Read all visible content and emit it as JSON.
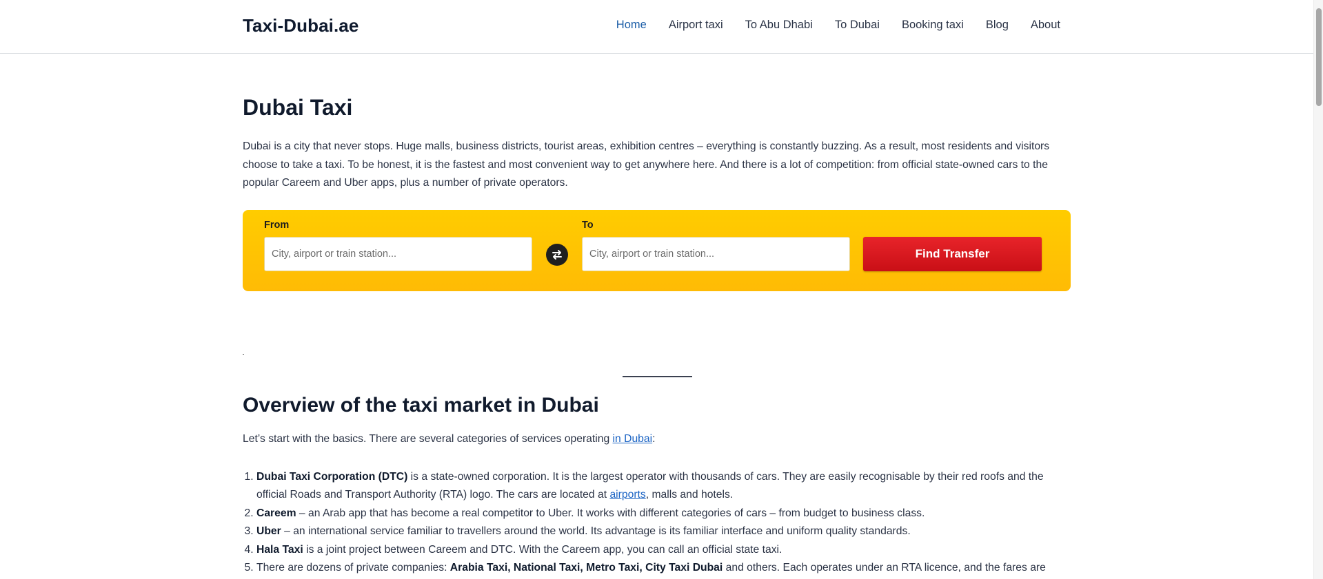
{
  "header": {
    "logo": "Taxi-Dubai.ae",
    "nav": [
      {
        "label": "Home",
        "active": true
      },
      {
        "label": "Airport taxi"
      },
      {
        "label": "To Abu Dhabi"
      },
      {
        "label": "To Dubai"
      },
      {
        "label": "Booking taxi"
      },
      {
        "label": "Blog"
      },
      {
        "label": "About"
      }
    ]
  },
  "hero": {
    "title": "Dubai Taxi",
    "intro": "Dubai is a city that never stops. Huge malls, business districts, tourist areas, exhibition centres – everything is constantly buzzing. As a result, most residents and visitors choose to take a taxi. To be honest, it is the fastest and most convenient way to get anywhere here. And there is a lot of competition: from official state-owned cars to the popular Careem and Uber apps, plus a number of private operators."
  },
  "search": {
    "from_label": "From",
    "from_placeholder": "City, airport or train station...",
    "to_label": "To",
    "to_placeholder": "City, airport or train station...",
    "swap_icon": "swap-arrows-icon",
    "button_label": "Find Transfer",
    "colors": {
      "panel": "#ffc400",
      "button": "#d8161d"
    }
  },
  "overview": {
    "title": "Overview of the taxi market in Dubai",
    "lead_text": "Let’s start with the basics. There are several categories of services operating ",
    "lead_link": "in Dubai",
    "lead_end": ":",
    "items": [
      {
        "bold": "Dubai Taxi Corporation (DTC)",
        "text": " is a state-owned corporation. It is the largest operator with thousands of cars. They are easily recognisable by their red roofs and the official Roads and Transport Authority (RTA) logo. The cars are located at ",
        "link": "airports",
        "after": ", malls and hotels."
      },
      {
        "bold": "Careem",
        "text": " – an Arab app that has become a real competitor to Uber. It works with different categories of cars – from budget to business class."
      },
      {
        "bold": "Uber",
        "text": " – an international service familiar to travellers around the world. Its advantage is its familiar interface and uniform quality standards."
      },
      {
        "bold": "Hala Taxi",
        "text": " is a joint project between Careem and DTC. With the Careem app, you can call an official state taxi."
      },
      {
        "pre": "There are dozens of private companies: ",
        "bold": "Arabia Taxi, National Taxi, Metro Taxi, City Taxi Dubai",
        "text": " and others. Each operates under an RTA licence, and the fares are"
      }
    ]
  }
}
